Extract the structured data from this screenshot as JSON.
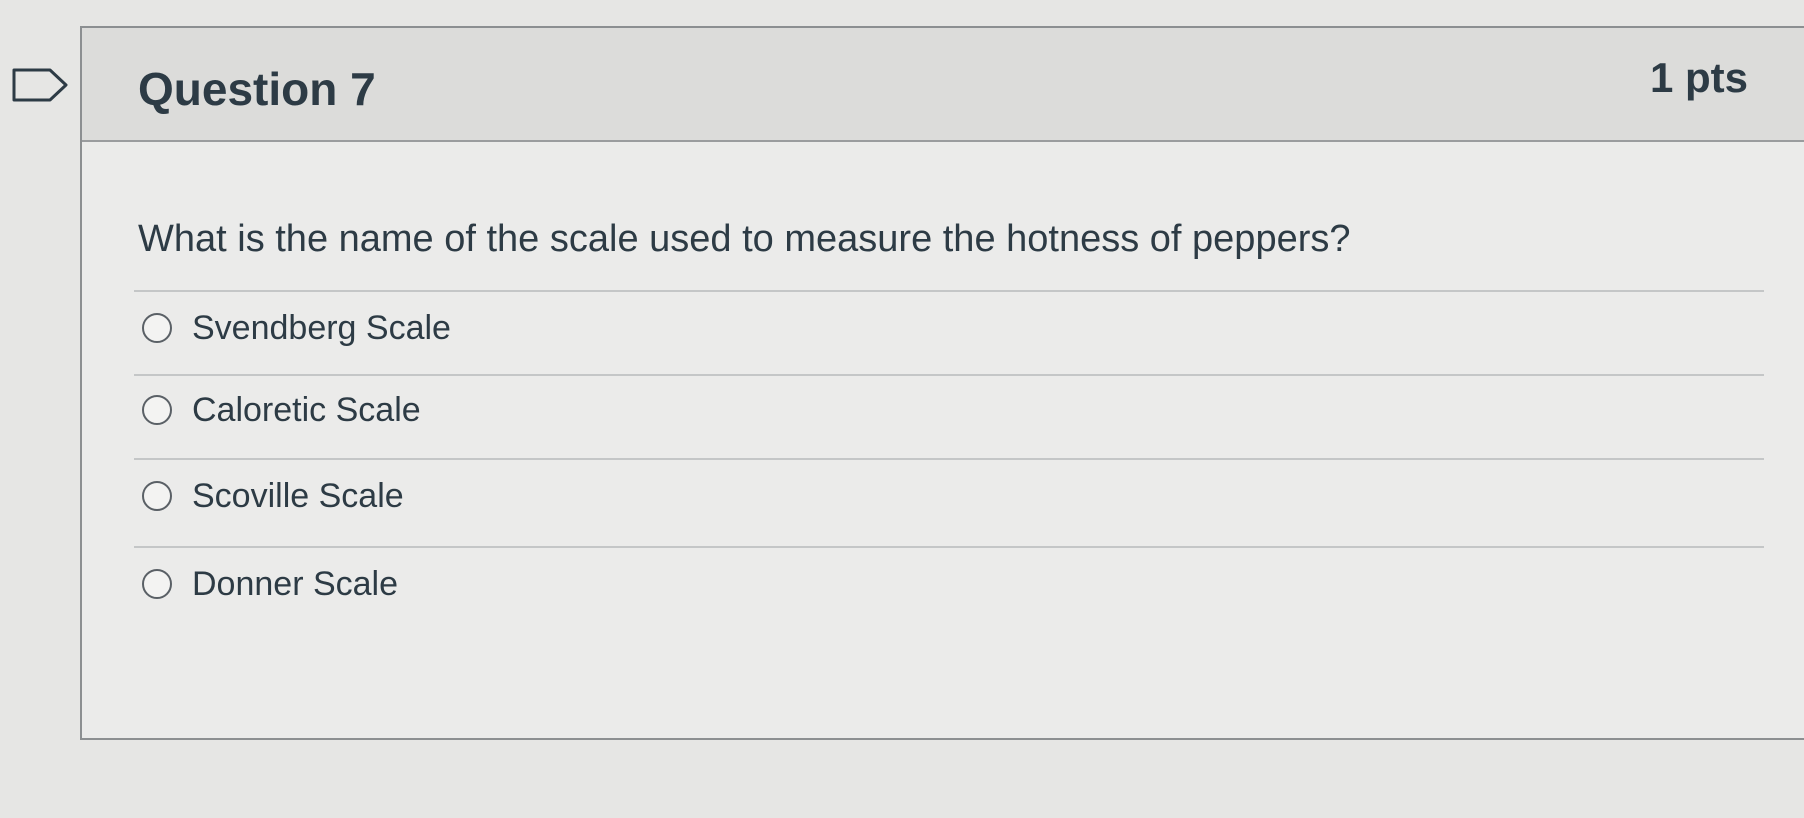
{
  "question": {
    "title": "Question 7",
    "points": "1 pts",
    "text": "What is the name of the scale used to measure the hotness of peppers?",
    "flag_icon": "flag-outline-icon"
  },
  "answers": [
    {
      "label": "Svendberg Scale",
      "selected": false
    },
    {
      "label": "Caloretic Scale",
      "selected": false
    },
    {
      "label": "Scoville Scale",
      "selected": false
    },
    {
      "label": "Donner Scale",
      "selected": false
    }
  ],
  "colors": {
    "text": "#2d3b45",
    "header_bg": "#dcdcda",
    "page_bg": "#e6e6e4",
    "border": "#8c8f91"
  }
}
